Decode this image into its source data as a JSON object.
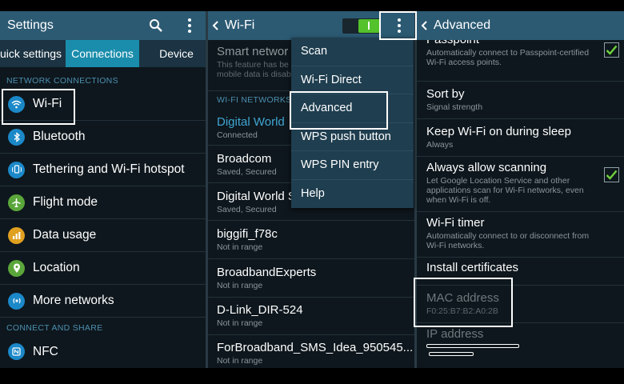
{
  "settings": {
    "title": "Settings",
    "tabs": [
      "uick settings",
      "Connections",
      "Device"
    ],
    "sections": {
      "network": "NETWORK CONNECTIONS",
      "share": "CONNECT AND SHARE"
    },
    "items": [
      {
        "label": "Wi-Fi",
        "icon": "wifi-icon",
        "color": "#1b88c8"
      },
      {
        "label": "Bluetooth",
        "icon": "bluetooth-icon",
        "color": "#1b88c8"
      },
      {
        "label": "Tethering and Wi-Fi hotspot",
        "icon": "tethering-icon",
        "color": "#1b88c8"
      },
      {
        "label": "Flight mode",
        "icon": "airplane-icon",
        "color": "#5aa63a"
      },
      {
        "label": "Data usage",
        "icon": "data-usage-icon",
        "color": "#e0a020"
      },
      {
        "label": "Location",
        "icon": "location-icon",
        "color": "#5aa63a"
      },
      {
        "label": "More networks",
        "icon": "more-networks-icon",
        "color": "#1b88c8"
      }
    ],
    "share_items": [
      {
        "label": "NFC",
        "icon": "nfc-icon",
        "color": "#1b88c8"
      }
    ]
  },
  "wifi": {
    "title": "Wi-Fi",
    "smart_network": {
      "title": "Smart networ",
      "desc1": "This feature has be",
      "desc2": "mobile data is disab"
    },
    "section": "WI-FI NETWORKS",
    "networks": [
      {
        "name": "Digital World",
        "status": "Connected"
      },
      {
        "name": "Broadcom",
        "status": "Saved, Secured"
      },
      {
        "name": "Digital World S",
        "status": "Saved, Secured"
      },
      {
        "name": "biggifi_f78c",
        "status": "Not in range"
      },
      {
        "name": "BroadbandExperts",
        "status": "Not in range"
      },
      {
        "name": "D-Link_DIR-524",
        "status": "Not in range"
      },
      {
        "name": "ForBroadband_SMS_Idea_950545...",
        "status": "Not in range"
      }
    ],
    "menu": [
      "Scan",
      "Wi-Fi Direct",
      "Advanced",
      "WPS push button",
      "WPS PIN entry",
      "Help"
    ]
  },
  "advanced": {
    "title": "Advanced",
    "passpoint": {
      "title": "Passpoint",
      "desc": "Automatically connect to Passpoint-certified Wi-Fi access points."
    },
    "sort_by": {
      "title": "Sort by",
      "desc": "Signal strength"
    },
    "keep_wifi": {
      "title": "Keep Wi-Fi on during sleep",
      "desc": "Always"
    },
    "always_scan": {
      "title": "Always allow scanning",
      "desc": "Let Google Location Service and other applications scan for Wi-Fi networks, even when Wi-Fi is off."
    },
    "wifi_timer": {
      "title": "Wi-Fi timer",
      "desc": "Automatically connect to or disconnect from Wi-Fi networks."
    },
    "install_certs": {
      "title": "Install certificates"
    },
    "mac": {
      "title": "MAC address",
      "value": "F0:25:B7:B2:A0:2B"
    },
    "ip": {
      "title": "IP address"
    }
  },
  "colors": {
    "accent": "#1a8dac",
    "titlebar": "#2c5a73",
    "toggle_on": "#53c22b",
    "check": "#6fd13d"
  }
}
